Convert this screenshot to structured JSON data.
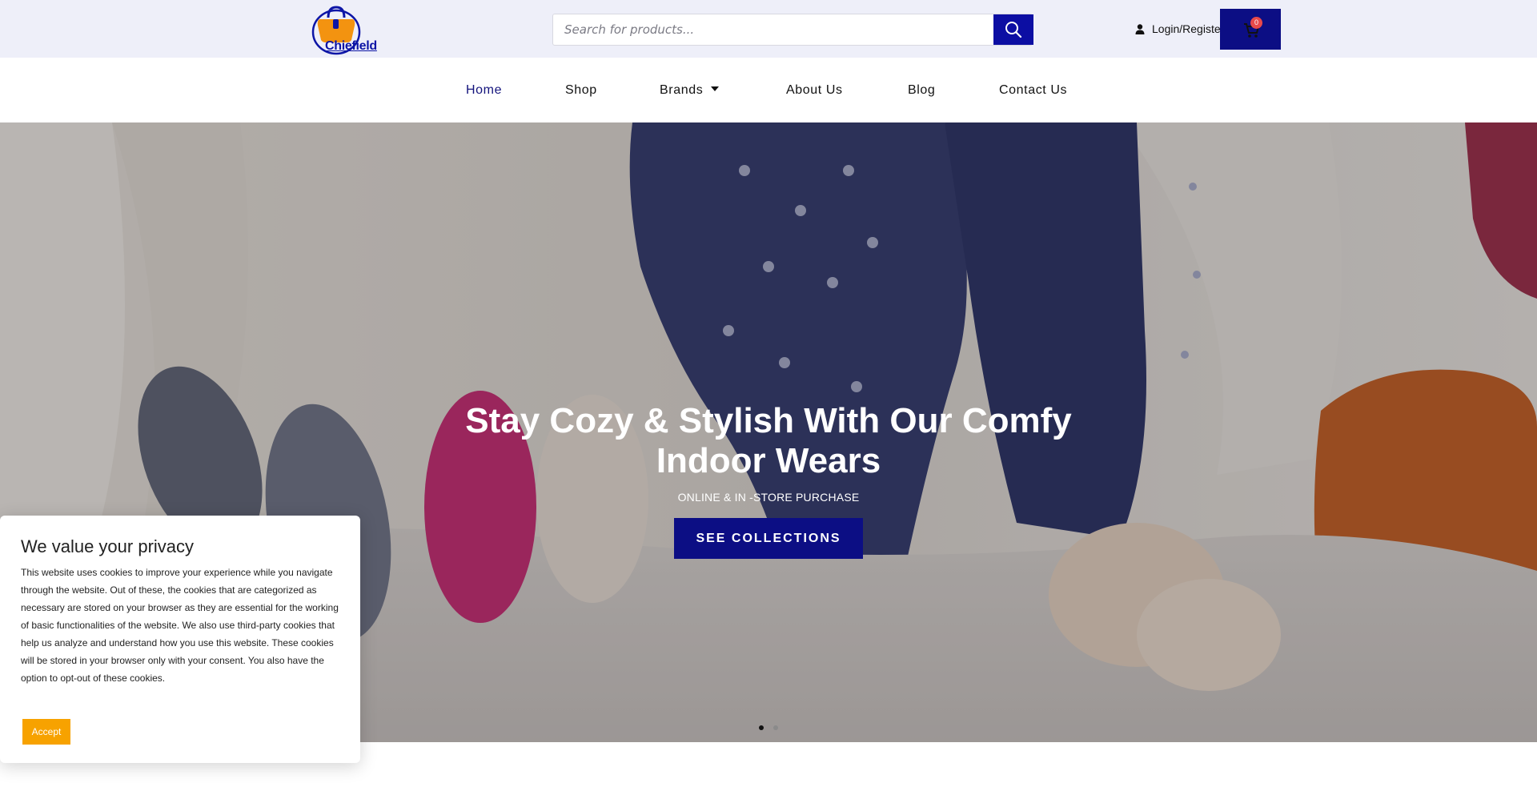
{
  "brand": {
    "logo_text": "Chiefield"
  },
  "search": {
    "placeholder": "Search for products..."
  },
  "account": {
    "login_label": "Login/Registe"
  },
  "cart": {
    "count": "0"
  },
  "nav": {
    "items": [
      {
        "label": "Home",
        "active": true
      },
      {
        "label": "Shop"
      },
      {
        "label": "Brands"
      },
      {
        "label": "About Us"
      },
      {
        "label": "Blog"
      },
      {
        "label": "Contact Us"
      }
    ]
  },
  "hero": {
    "title": "Stay Cozy & Stylish With Our Comfy Indoor Wears",
    "subtitle": "ONLINE & IN -STORE PURCHASE",
    "cta_label": "SEE COLLECTIONS",
    "slides": 2,
    "active_slide": 1
  },
  "cookie": {
    "title": "We value your privacy",
    "body": "This website uses cookies to improve your experience while you navigate through the website. Out of these, the cookies that are categorized as necessary are stored on your browser as they are essential for the working of basic functionalities of the website. We also use third-party cookies that help us analyze and understand how you use this website. These cookies will be stored in your browser only with your consent. You also have the option to opt-out of these cookies.",
    "accept_label": "Accept"
  },
  "colors": {
    "primary": "#0c0e84",
    "header_bg": "#eeeff9",
    "accept": "#f7a200",
    "badge": "#e8494a"
  },
  "icons": [
    "handbag-logo-icon",
    "search-icon",
    "user-icon",
    "cart-icon",
    "chevron-down-icon"
  ]
}
